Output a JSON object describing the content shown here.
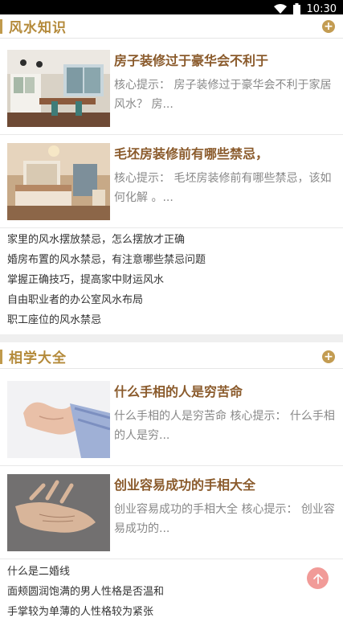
{
  "status_bar": {
    "time": "10:30"
  },
  "sections": [
    {
      "title": "风水知识",
      "articles": [
        {
          "title": "房子装修过于豪华会不利于",
          "summary": "核心提示： 房子装修过于豪华会不利于家居风水？ 房..."
        },
        {
          "title": "毛坯房装修前有哪些禁忌，",
          "summary": "核心提示： 毛坯房装修前有哪些禁忌，该如何化解 。..."
        }
      ],
      "links": [
        "家里的风水摆放禁忌，怎么摆放才正确",
        "婚房布置的风水禁忌，有注意哪些禁忌问题",
        "掌握正确技巧，提高家中财运风水",
        "自由职业者的办公室风水布局",
        "职工座位的风水禁忌"
      ]
    },
    {
      "title": "相学大全",
      "articles": [
        {
          "title": "什么手相的人是穷苦命",
          "summary": "什么手相的人是穷苦命 核心提示： 什么手相的人是穷..."
        },
        {
          "title": "创业容易成功的手相大全",
          "summary": "创业容易成功的手相大全 核心提示： 创业容易成功的..."
        }
      ],
      "links": [
        "什么是二婚线",
        "面颊圆润饱满的男人性格是否温和",
        "手掌较为单薄的人性格较为紧张"
      ]
    }
  ],
  "icons": {
    "plus": "plus-circle-icon",
    "back_to_top": "arrow-up-icon",
    "wifi": "wifi-icon"
  },
  "colors": {
    "accent": "#c09a4c",
    "title": "#8a5a2b",
    "fab": "#f19b98"
  }
}
